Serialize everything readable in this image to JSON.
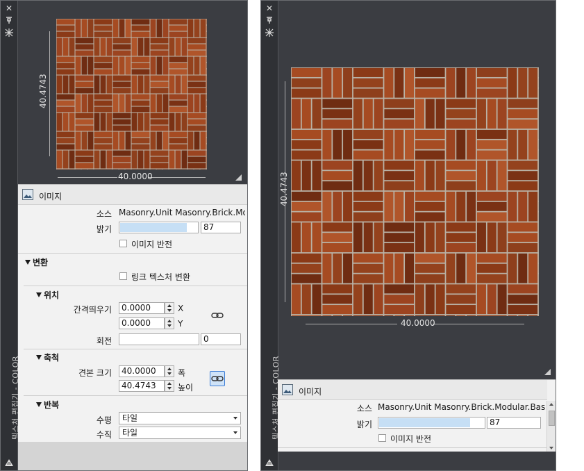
{
  "panel_title": "텍스처 편집기 - COLOR",
  "dimension_width": "40.0000",
  "dimension_height": "40.4743",
  "image_section": {
    "title": "이미지",
    "source_label": "소스",
    "source_value_short": "Masonry.Unit Masonry.Brick.Moc",
    "source_value_long": "Masonry.Unit Masonry.Brick.Modular.Basket",
    "brightness_label": "밝기",
    "brightness_value": "87",
    "brightness_percent": 87,
    "invert_label": "이미지 반전",
    "invert_checked": false
  },
  "transform_section": {
    "title": "변환",
    "link_label": "링크 텍스처 변환",
    "link_checked": false,
    "position": {
      "title": "위치",
      "offset_label": "간격띄우기",
      "x_value": "0.0000",
      "x_axis": "X",
      "y_value": "0.0000",
      "y_axis": "Y",
      "rotation_label": "회전",
      "rotation_value": "0"
    },
    "scale": {
      "title": "축척",
      "sample_size_label": "견본 크기",
      "width_value": "40.0000",
      "width_label": "폭",
      "height_value": "40.4743",
      "height_label": "높이"
    },
    "repeat": {
      "title": "반복",
      "horizontal_label": "수평",
      "horizontal_value": "타일",
      "vertical_label": "수직",
      "vertical_value": "타일"
    }
  },
  "colors": {
    "panel_bg": "#3b3d42",
    "props_bg": "#f2f2f2",
    "slider_fill": "#c6dff5",
    "accent": "#3a7bd5"
  }
}
